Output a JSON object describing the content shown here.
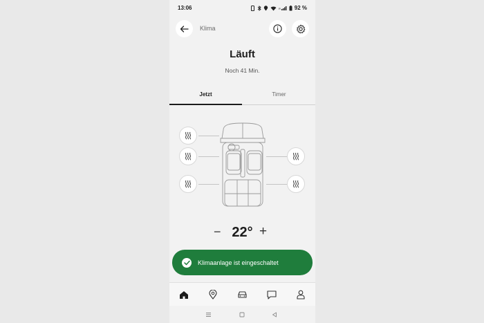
{
  "status_bar": {
    "time": "13:06",
    "battery": "92 %",
    "icons": [
      "vibrate-icon",
      "bluetooth-icon",
      "location-icon",
      "wifi-icon",
      "signal-icon",
      "battery-icon"
    ]
  },
  "header": {
    "title": "Klima",
    "back_icon": "arrow-left-icon",
    "info_icon": "info-icon",
    "settings_icon": "gear-icon"
  },
  "main": {
    "status_title": "Läuft",
    "remaining": "Noch 41 Min."
  },
  "tabs": [
    {
      "label": "Jetzt",
      "active": true
    },
    {
      "label": "Timer",
      "active": false
    }
  ],
  "seat_heating": {
    "windshield": "windshield-heat-icon",
    "driver_front": "seat-heat-icon",
    "passenger_front": "seat-heat-icon",
    "rear_left": "seat-heat-icon",
    "rear_right": "seat-heat-icon"
  },
  "temperature": {
    "value": "22°",
    "minus_label": "−",
    "plus_label": "+"
  },
  "toast": {
    "message": "Klimaanlage ist eingeschaltet",
    "icon": "check-icon",
    "color": "#1f7d3c"
  },
  "bottom_nav": {
    "items": [
      "home-icon",
      "map-pin-icon",
      "car-icon",
      "chat-icon",
      "profile-icon"
    ],
    "active": "home-icon"
  },
  "system_nav": [
    "menu-icon",
    "home-square-icon",
    "back-triangle-icon"
  ]
}
